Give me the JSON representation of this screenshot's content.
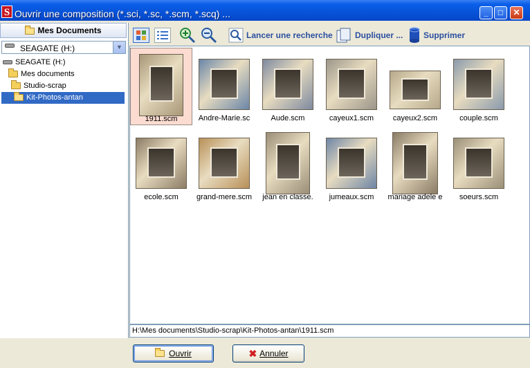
{
  "window": {
    "title": "Ouvrir une composition (*.sci, *.sc, *.scm, *.scq) ...",
    "app_icon_letter": "S",
    "minimize_glyph": "_",
    "maximize_glyph": "□",
    "close_glyph": "✕"
  },
  "sidebar": {
    "header": "Mes Documents",
    "drive_combo": "SEAGATE (H:)",
    "tree": [
      {
        "label": "SEAGATE (H:)"
      },
      {
        "label": "Mes documents"
      },
      {
        "label": "Studio-scrap"
      },
      {
        "label": "Kit-Photos-antan"
      }
    ]
  },
  "toolbar": {
    "search": "Lancer une recherche",
    "duplicate": "Dupliquer ...",
    "delete": "Supprimer"
  },
  "files": [
    {
      "name": "1911.scm",
      "color": "#a89878"
    },
    {
      "name": "Andre-Marie.sc",
      "color": "#6a86a8"
    },
    {
      "name": "Aude.scm",
      "color": "#7e8aa0"
    },
    {
      "name": "cayeux1.scm",
      "color": "#9c968a"
    },
    {
      "name": "cayeux2.scm",
      "color": "#b5a88a"
    },
    {
      "name": "couple.scm",
      "color": "#8a9aac"
    },
    {
      "name": "ecole.scm",
      "color": "#8c7c66"
    },
    {
      "name": "grand-mere.scm",
      "color": "#b89058"
    },
    {
      "name": "jean en classe.",
      "color": "#9a8e78"
    },
    {
      "name": "jumeaux.scm",
      "color": "#6e86a6"
    },
    {
      "name": "mariage adele e",
      "color": "#8a7c66"
    },
    {
      "name": "soeurs.scm",
      "color": "#9a9078"
    }
  ],
  "status_path": "H:\\Mes documents\\Studio-scrap\\Kit-Photos-antan\\1911.scm",
  "buttons": {
    "open": "Ouvrir",
    "cancel": "Annuler"
  }
}
